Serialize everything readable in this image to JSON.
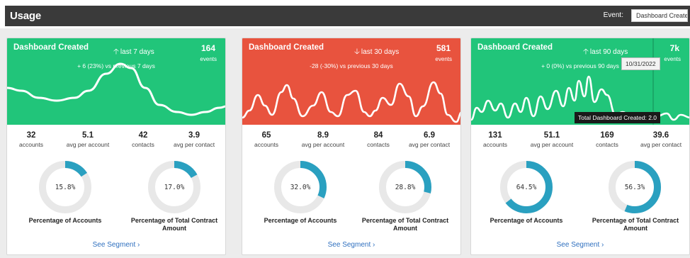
{
  "header": {
    "title": "Usage",
    "event_label": "Event:",
    "event_value": "Dashboard Created",
    "event_chevron": "chevron-down-icon"
  },
  "colors": {
    "green": "#21c57a",
    "red": "#e8533e",
    "donut": "#2aa0c0",
    "donut_track": "#e8e8e8"
  },
  "cards": [
    {
      "title": "Dashboard Created",
      "direction": "up",
      "range": "last 7 days",
      "count": "164",
      "count_unit": "events",
      "delta": "+ 6 (23%) vs previous 7 days",
      "color": "#21c57a",
      "stats": [
        {
          "value": "32",
          "label": "accounts"
        },
        {
          "value": "5.1",
          "label": "avg per account"
        },
        {
          "value": "42",
          "label": "contacts"
        },
        {
          "value": "3.9",
          "label": "avg per contact"
        }
      ],
      "donuts": [
        {
          "pct": 15.8,
          "text": "15.8%",
          "label": "Percentage of Accounts"
        },
        {
          "pct": 17.0,
          "text": "17.0%",
          "label": "Percentage of Total Contract Amount"
        }
      ],
      "link": "See Segment",
      "link_icon": "chevron-right-icon"
    },
    {
      "title": "Dashboard Created",
      "direction": "down",
      "range": "last 30 days",
      "count": "581",
      "count_unit": "events",
      "delta": "-28 (-30%) vs previous 30 days",
      "color": "#e8533e",
      "stats": [
        {
          "value": "65",
          "label": "accounts"
        },
        {
          "value": "8.9",
          "label": "avg per account"
        },
        {
          "value": "84",
          "label": "contacts"
        },
        {
          "value": "6.9",
          "label": "avg per contact"
        }
      ],
      "donuts": [
        {
          "pct": 32.0,
          "text": "32.0%",
          "label": "Percentage of Accounts"
        },
        {
          "pct": 28.8,
          "text": "28.8%",
          "label": "Percentage of Total Contract Amount"
        }
      ],
      "link": "See Segment",
      "link_icon": "chevron-right-icon"
    },
    {
      "title": "Dashboard Created",
      "direction": "up",
      "range": "last 90 days",
      "count": "7k",
      "count_unit": "events",
      "delta": "+ 0 (0%) vs previous 90 days",
      "color": "#21c57a",
      "tooltip_date": "10/31/2022",
      "tooltip_total": "Total Dashboard Created: 2.0",
      "stats": [
        {
          "value": "131",
          "label": "accounts"
        },
        {
          "value": "51.1",
          "label": "avg per account"
        },
        {
          "value": "169",
          "label": "contacts"
        },
        {
          "value": "39.6",
          "label": "avg per contact"
        }
      ],
      "donuts": [
        {
          "pct": 64.5,
          "text": "64.5%",
          "label": "Percentage of Accounts"
        },
        {
          "pct": 56.3,
          "text": "56.3%",
          "label": "Percentage of Total Contract Amount"
        }
      ],
      "link": "See Segment",
      "link_icon": "chevron-right-icon"
    }
  ]
}
